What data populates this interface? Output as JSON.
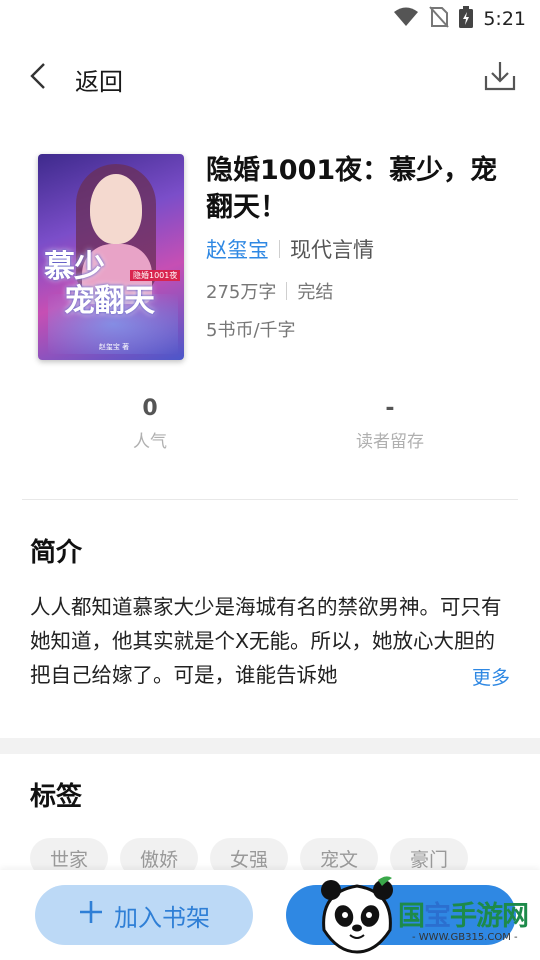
{
  "status_bar": {
    "time": "5:21"
  },
  "nav": {
    "back_label": "返回"
  },
  "book": {
    "title": "隐婚1001夜：慕少，宠翻天！",
    "author": "赵玺宝",
    "genre": "现代言情",
    "word_count": "275万字",
    "status": "完结",
    "price": "5书币/千字",
    "cover": {
      "title_line1": "慕少",
      "title_line2": "宠翻天",
      "badge": "隐婚1001夜",
      "author": "赵玺宝 著"
    }
  },
  "stats": [
    {
      "value": "0",
      "label": "人气"
    },
    {
      "value": "-",
      "label": "读者留存"
    }
  ],
  "intro": {
    "heading": "简介",
    "text": "人人都知道慕家大少是海城有名的禁欲男神。可只有她知道，他其实就是个X无能。所以，她放心大胆的把自己给嫁了。可是，谁能告诉她",
    "more": "更多"
  },
  "tags_section": {
    "heading": "标签",
    "items": [
      "世家",
      "傲娇",
      "女强",
      "宠文",
      "豪门"
    ]
  },
  "bottom": {
    "add_shelf_label": "加入书架"
  },
  "watermark": {
    "name_a": "国",
    "name_b": "宝",
    "name_c": "手游网",
    "url": "- WWW.GB315.COM -"
  },
  "colors": {
    "accent": "#2f88e3",
    "button_light": "#bcd9f6"
  }
}
